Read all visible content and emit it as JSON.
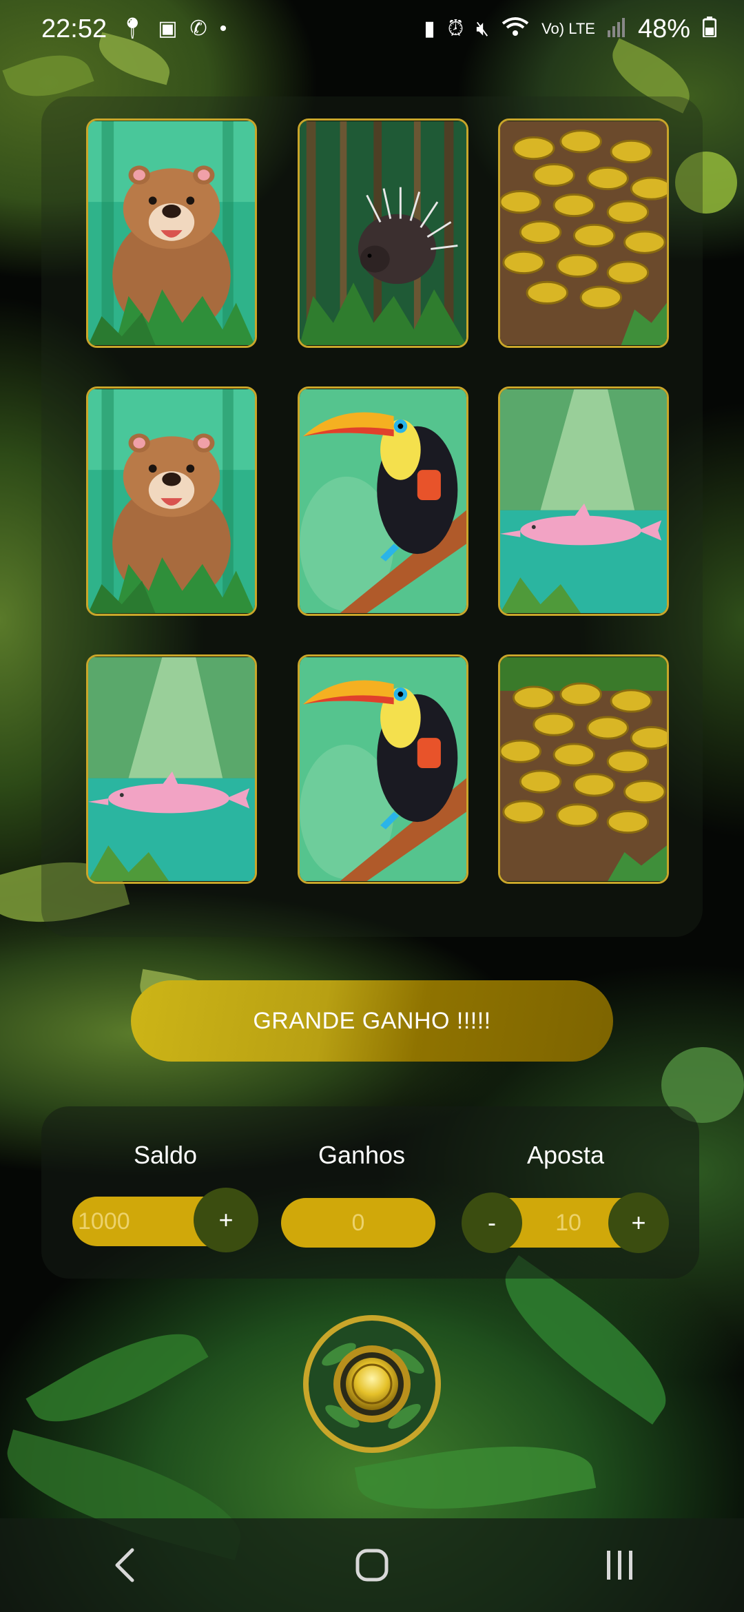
{
  "status_bar": {
    "time": "22:52",
    "battery": "48%",
    "left_icons": [
      "location-icon",
      "gallery-icon",
      "whatsapp-icon",
      "dot-icon"
    ],
    "right_icons": [
      "battery-saver-icon",
      "alarm-icon",
      "mute-icon",
      "wifi-icon",
      "volte-icon",
      "signal-icon",
      "battery-icon"
    ],
    "network_label": "Vo) LTE"
  },
  "slot_grid": {
    "rows": [
      [
        "capybara",
        "porcupine",
        "gold-coins"
      ],
      [
        "capybara",
        "toucan",
        "pink-dolphin"
      ],
      [
        "pink-dolphin",
        "toucan",
        "gold-coins"
      ]
    ]
  },
  "win_banner": {
    "text": "GRANDE GANHO !!!!!"
  },
  "controls": {
    "saldo": {
      "label": "Saldo",
      "value": "1000",
      "plus": "+"
    },
    "ganhos": {
      "label": "Ganhos",
      "value": "0"
    },
    "aposta": {
      "label": "Aposta",
      "value": "10",
      "minus": "-",
      "plus": "+"
    }
  },
  "colors": {
    "gold": "#d0a80a",
    "dark_olive": "#3b4d10",
    "tile_border": "#c9a62a"
  },
  "nav": {
    "icons": [
      "back-icon",
      "home-icon",
      "recents-icon"
    ]
  }
}
